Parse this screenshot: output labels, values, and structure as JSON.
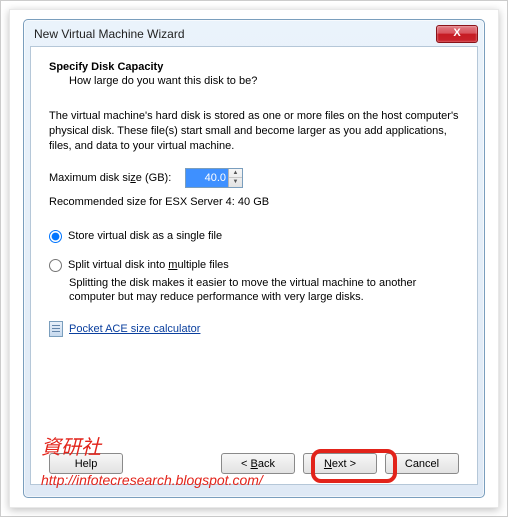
{
  "window": {
    "title": "New Virtual Machine Wizard",
    "close_x": "X"
  },
  "page": {
    "heading": "Specify Disk Capacity",
    "subheading": "How large do you want this disk to be?",
    "description": "The virtual machine's hard disk is stored as one or more files on the host computer's physical disk. These file(s) start small and become larger as you add applications, files, and data to your virtual machine.",
    "max_label_pre": "Maximum disk si",
    "max_label_u": "z",
    "max_label_post": "e (GB):",
    "max_value": "40.0",
    "recommended": "Recommended size for ESX Server 4: 40 GB",
    "radio_single": "Store virtual disk as a single file",
    "radio_split_pre": "Split virtual disk into ",
    "radio_split_u": "m",
    "radio_split_post": "ultiple files",
    "split_hint": "Splitting the disk makes it easier to move the virtual machine to another computer but may reduce performance with very large disks.",
    "calc_link": "Pocket ACE size calculator"
  },
  "buttons": {
    "help": "Help",
    "back_pre": "< ",
    "back_u": "B",
    "back_post": "ack",
    "next_pre": "",
    "next_u": "N",
    "next_post": "ext >",
    "cancel": "Cancel"
  },
  "watermark": {
    "cn": "資研社",
    "url": "http://infotecresearch.blogspot.com/"
  }
}
